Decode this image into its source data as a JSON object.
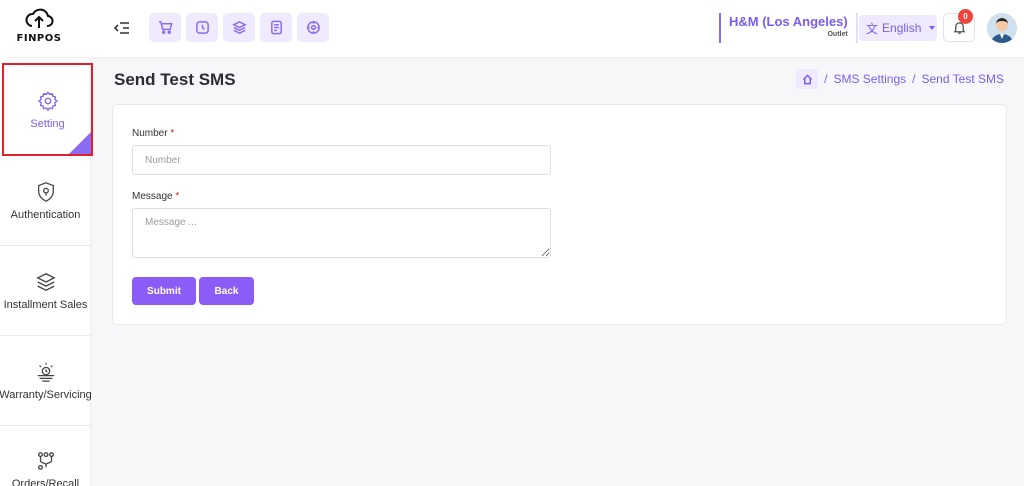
{
  "app": {
    "logo_text": "FINPOS"
  },
  "header": {
    "quick_icons": [
      "cart-icon",
      "clock-icon",
      "layers-icon",
      "document-icon",
      "compass-icon"
    ],
    "store_name": "H&M (Los Angeles)",
    "store_sub": "Outlet",
    "language": "English",
    "notification_count": "0"
  },
  "sidebar": {
    "items": [
      {
        "label": "Setting",
        "icon": "gear-icon",
        "active": true
      },
      {
        "label": "Authentication",
        "icon": "shield-icon"
      },
      {
        "label": "Installment Sales",
        "icon": "layers-icon"
      },
      {
        "label": "Warranty/Servicing",
        "icon": "warranty-icon"
      },
      {
        "label": "Orders/Recall",
        "icon": "route-icon"
      }
    ]
  },
  "page": {
    "title": "Send Test SMS",
    "breadcrumb": [
      "SMS Settings",
      "Send Test SMS"
    ]
  },
  "form": {
    "number_label": "Number",
    "number_placeholder": "Number",
    "message_label": "Message",
    "message_placeholder": "Message ...",
    "required_mark": "*",
    "submit_label": "Submit",
    "back_label": "Back"
  },
  "colors": {
    "accent": "#8b5cf6",
    "active_outline": "#e0202a",
    "badge": "#f0443e"
  }
}
